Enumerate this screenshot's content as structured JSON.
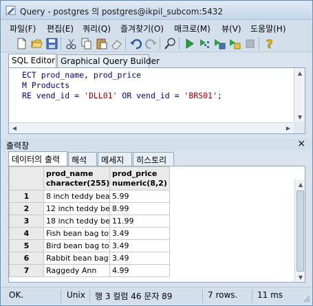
{
  "window": {
    "title": "Query - postgres 의 postgres@ikpil_subcom:5432"
  },
  "menu": {
    "items": [
      "파일(F)",
      "편집(E)",
      "쿼리(Q)",
      "즐겨찾기(O)",
      "매크로(M)",
      "뷰(V)",
      "도움말(H)"
    ]
  },
  "toolbar": {
    "icons": [
      "new-file-icon",
      "open-folder-icon",
      "save-icon",
      "cut-icon",
      "copy-icon",
      "paste-icon",
      "eraser-icon",
      "undo-icon",
      "redo-icon",
      "find-icon",
      "execute-icon",
      "explain-icon",
      "execute-to-file-icon",
      "analyze-icon",
      "stop-icon",
      "help-icon"
    ]
  },
  "editor_tabs": [
    "SQL Editor",
    "Graphical Query Builder"
  ],
  "editor": {
    "lines": [
      {
        "pre": "ECT prod_name, prod_price",
        "str1": "",
        "mid": "",
        "str2": "",
        "post": ""
      },
      {
        "pre": "M Products",
        "str1": "",
        "mid": "",
        "str2": "",
        "post": ""
      },
      {
        "pre": "RE vend_id = ",
        "str1": "'DLL01'",
        "mid": " OR vend_id = ",
        "str2": "'BRS01'",
        "post": ";"
      }
    ]
  },
  "output": {
    "title": "출력창",
    "close": "×",
    "tabs": [
      "데이터의 출력",
      "해석",
      "메세지",
      "히스토리"
    ]
  },
  "grid": {
    "columns": [
      {
        "name": "prod_name",
        "type": "character(255)"
      },
      {
        "name": "prod_price",
        "type": "numeric(8,2)"
      }
    ],
    "rows": [
      {
        "num": "1",
        "name": "8 inch teddy bea",
        "price": "5.99"
      },
      {
        "num": "2",
        "name": "12 inch teddy be",
        "price": "8.99"
      },
      {
        "num": "3",
        "name": "18 inch teddy be",
        "price": "11.99"
      },
      {
        "num": "4",
        "name": "Fish bean bag toy",
        "price": "3.49"
      },
      {
        "num": "5",
        "name": "Bird bean bag toy",
        "price": "3.49"
      },
      {
        "num": "6",
        "name": "Rabbit bean bag",
        "price": "3.49"
      },
      {
        "num": "7",
        "name": "Raggedy Ann",
        "price": "4.99"
      }
    ]
  },
  "status": {
    "state": "OK.",
    "line_ending": "Unix",
    "position": "행 3 컬럼 46 문자 89",
    "rows": "7 rows.",
    "time": "11 ms"
  }
}
